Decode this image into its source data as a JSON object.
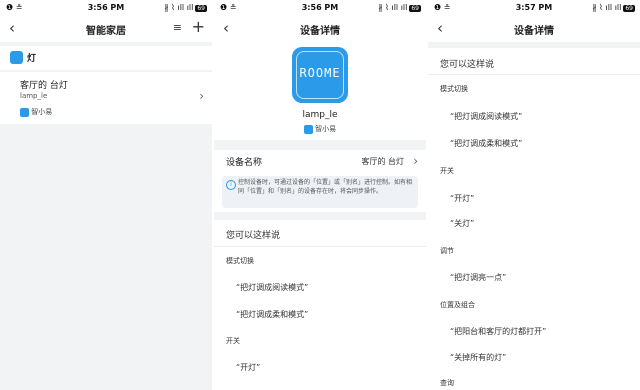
{
  "panels": [
    {
      "status": {
        "carrier": "❶ ≗",
        "time": "3:56 PM",
        "icons": "∦ ⌇ ıll ıll",
        "battery": "69"
      },
      "nav": {
        "title": "智能家居",
        "menu_icon": "≡",
        "add_icon": "+"
      },
      "group": {
        "label": "灯"
      },
      "device": {
        "name": "客厅的 台灯",
        "id": "lamp_le",
        "via": "智小易"
      }
    },
    {
      "status": {
        "carrier": "❶ ≗",
        "time": "3:56 PM",
        "icons": "∦ ⌇ ıll ıll",
        "battery": "69"
      },
      "nav": {
        "title": "设备详情"
      },
      "logo_text": "ROOME",
      "device": {
        "name": "lamp_le",
        "via": "智小易"
      },
      "name_row": {
        "label": "设备名称",
        "value": "客厅的 台灯"
      },
      "info": {
        "icon": "i",
        "text": "控制设备时，可通过设备的「位置」或「别名」进行控制。如有相同「位置」和「别名」的设备存在时，将会同步操作。"
      },
      "phrases": {
        "title": "您可以这样说",
        "mode_cat": "模式切换",
        "mode_cmds": [
          "“把灯调成阅读模式”",
          "“把灯调成柔和模式”"
        ],
        "switch_cat": "开关",
        "switch_cmds": [
          "“开灯”"
        ]
      }
    },
    {
      "status": {
        "carrier": "❶ ≗",
        "time": "3:57 PM",
        "icons": "∦ ⌇ ıll ıll",
        "battery": "69"
      },
      "nav": {
        "title": "设备详情"
      },
      "phrases": {
        "title": "您可以这样说",
        "mode_cat": "模式切换",
        "mode_cmds": [
          "“把灯调成阅读模式”",
          "“把灯调成柔和模式”"
        ],
        "switch_cat": "开关",
        "switch_cmds": [
          "“开灯”",
          "“关灯”"
        ],
        "adjust_cat": "调节",
        "adjust_cmds": [
          "“把灯调亮一点”"
        ],
        "location_cat": "位置及组合",
        "location_cmds": [
          "“把阳台和客厅的灯都打开”",
          "“关掉所有的灯”"
        ],
        "query_cat": "查询"
      }
    }
  ],
  "icons": {
    "back": "‹",
    "chevron": "›"
  },
  "colors": {
    "accent": "#2b9ae8",
    "background": "#f2f3f5"
  }
}
